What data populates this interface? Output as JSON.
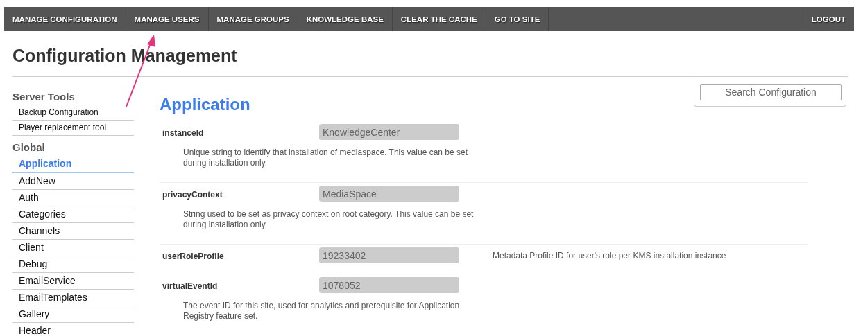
{
  "nav": {
    "items": [
      {
        "label": "MANAGE CONFIGURATION",
        "selected": false
      },
      {
        "label": "MANAGE USERS",
        "selected": false
      },
      {
        "label": "MANAGE GROUPS",
        "selected": false
      },
      {
        "label": "KNOWLEDGE BASE",
        "selected": false
      },
      {
        "label": "CLEAR THE CACHE",
        "selected": false
      },
      {
        "label": "GO TO SITE",
        "selected": false
      }
    ],
    "logout": "LOGOUT"
  },
  "page_title": "Configuration Management",
  "sidebar": {
    "sections": [
      {
        "title": "Server Tools",
        "kind": "tools",
        "items": [
          {
            "label": "Backup Configuration",
            "selected": false
          },
          {
            "label": "Player replacement tool",
            "selected": false
          }
        ]
      },
      {
        "title": "Global",
        "kind": "modules",
        "items": [
          {
            "label": "Application",
            "selected": true
          },
          {
            "label": "AddNew",
            "selected": false
          },
          {
            "label": "Auth",
            "selected": false
          },
          {
            "label": "Categories",
            "selected": false
          },
          {
            "label": "Channels",
            "selected": false
          },
          {
            "label": "Client",
            "selected": false
          },
          {
            "label": "Debug",
            "selected": false
          },
          {
            "label": "EmailService",
            "selected": false
          },
          {
            "label": "EmailTemplates",
            "selected": false
          },
          {
            "label": "Gallery",
            "selected": false
          },
          {
            "label": "Header",
            "selected": false
          }
        ]
      }
    ]
  },
  "content": {
    "heading": "Application",
    "settings": [
      {
        "name": "instanceId",
        "value": "KnowledgeCenter",
        "disabled": true,
        "kind": "below",
        "description": "Unique string to identify that installation of mediaspace. This value can be set during installation only."
      },
      {
        "name": "privacyContext",
        "value": "MediaSpace",
        "disabled": true,
        "kind": "below",
        "description": "String used to be set as privacy context on root category. This value can be set during installation only."
      },
      {
        "name": "userRoleProfile",
        "value": "19233402",
        "disabled": true,
        "kind": "side",
        "description": "Metadata Profile ID for user's role per KMS installation instance"
      },
      {
        "name": "virtualEventId",
        "value": "1078052",
        "disabled": true,
        "kind": "below",
        "description": "The event ID for this site, used for analytics and prerequisite for Application Registry feature set."
      }
    ]
  },
  "search": {
    "placeholder": "Search Configuration"
  }
}
